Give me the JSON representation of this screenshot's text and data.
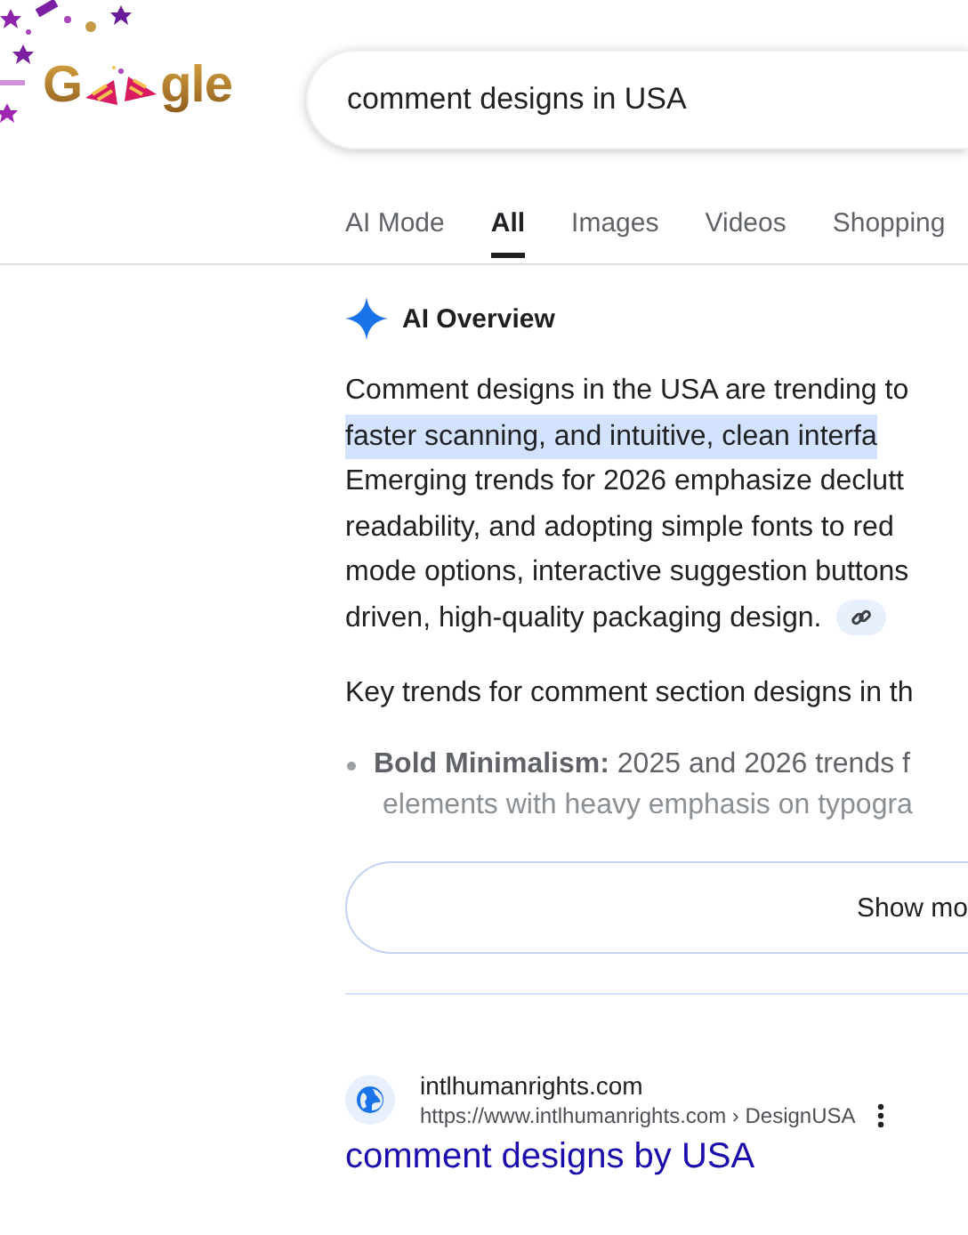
{
  "logo": {
    "left": "G",
    "right": "gle"
  },
  "search": {
    "value": "comment designs in USA"
  },
  "tabs": [
    {
      "label": "AI Mode",
      "selected": false
    },
    {
      "label": "All",
      "selected": true
    },
    {
      "label": "Images",
      "selected": false
    },
    {
      "label": "Videos",
      "selected": false
    },
    {
      "label": "Shopping",
      "selected": false
    }
  ],
  "ai_overview": {
    "title": "AI Overview",
    "lines": [
      {
        "text": "Comment designs in the USA are trending to",
        "highlighted": false
      },
      {
        "text": "faster scanning, and intuitive, clean interfa",
        "highlighted": true
      },
      {
        "text": "Emerging trends for 2026 emphasize declutt",
        "highlighted": false
      },
      {
        "text": "readability, and adopting simple fonts to red",
        "highlighted": false
      },
      {
        "text": "mode options, interactive suggestion buttons",
        "highlighted": false
      },
      {
        "text": "driven, high-quality packaging design.",
        "highlighted": false
      }
    ],
    "key_trends": "Key trends for comment section designs in th",
    "bullet_lines": [
      "**Bold Minimalism:** 2025 and 2026 trends f",
      "elements with heavy emphasis on typogra"
    ],
    "show_more": "Show mo"
  },
  "result": {
    "site": "intlhumanrights.com",
    "url": "https://www.intlhumanrights.com › DesignUSA",
    "title": "comment designs by USA"
  }
}
